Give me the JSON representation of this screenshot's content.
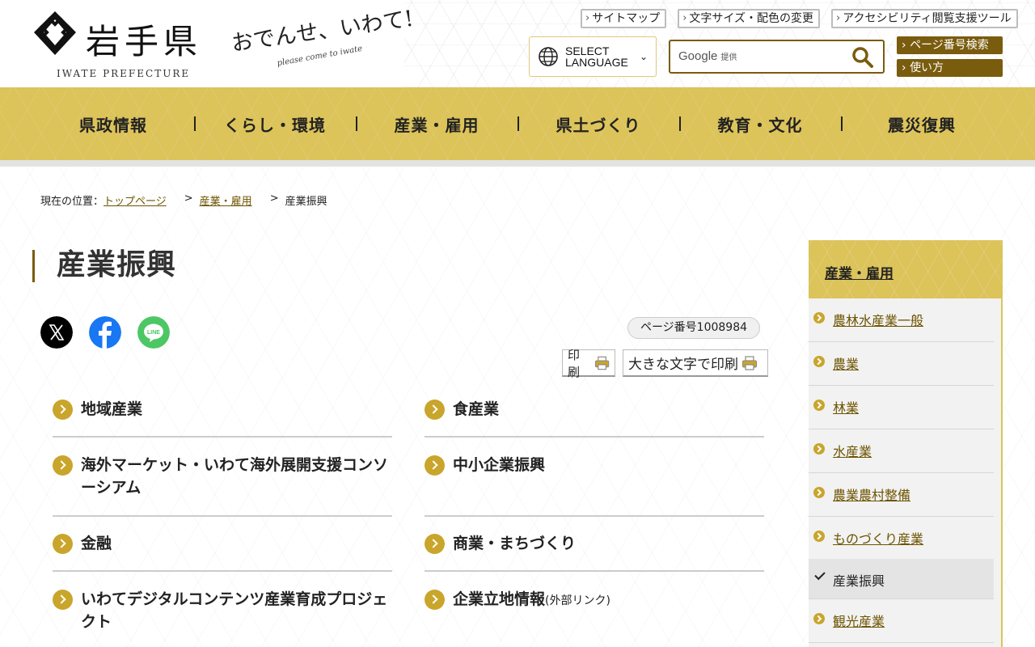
{
  "header": {
    "logo_name": "岩手県",
    "logo_en": "IWATE PREFECTURE",
    "slogan": "おでんせ、いわて!",
    "slogan_en": "please come to iwate",
    "top_links": [
      "サイトマップ",
      "文字サイズ・配色の変更",
      "アクセシビリティ閲覧支援ツール"
    ],
    "language_label_1": "SELECT",
    "language_label_2": "LANGUAGE",
    "search_brand": "Google",
    "search_provided": "提供",
    "page_number_search": "ページ番号検索",
    "how_to_use": "使い方"
  },
  "nav": [
    "県政情報",
    "くらし・環境",
    "産業・雇用",
    "県土づくり",
    "教育・文化",
    "震災復興"
  ],
  "breadcrumb": {
    "prefix": "現在の位置：",
    "items": [
      "トップページ",
      "産業・雇用",
      "産業振興"
    ]
  },
  "page": {
    "title": "産業振興",
    "page_number": "ページ番号1008984",
    "print": "印刷",
    "print_large": "大きな文字で印刷"
  },
  "links": [
    {
      "label": "地域産業",
      "ext": ""
    },
    {
      "label": "食産業",
      "ext": ""
    },
    {
      "label": "海外マーケット・いわて海外展開支援コンソーシアム",
      "ext": ""
    },
    {
      "label": "中小企業振興",
      "ext": ""
    },
    {
      "label": "金融",
      "ext": ""
    },
    {
      "label": "商業・まちづくり",
      "ext": ""
    },
    {
      "label": "いわてデジタルコンテンツ産業育成プロジェクト",
      "ext": ""
    },
    {
      "label": "企業立地情報",
      "ext": "(外部リンク)"
    }
  ],
  "sidebar": {
    "heading": "産業・雇用",
    "items": [
      "農林水産業一般",
      "農業",
      "林業",
      "水産業",
      "農業農村整備",
      "ものづくり産業",
      "産業振興",
      "観光産業"
    ],
    "current": "産業振興"
  },
  "colors": {
    "gold": "#dcc35a",
    "brown": "#7a5c0e",
    "link_icon": "#c9a52b"
  }
}
